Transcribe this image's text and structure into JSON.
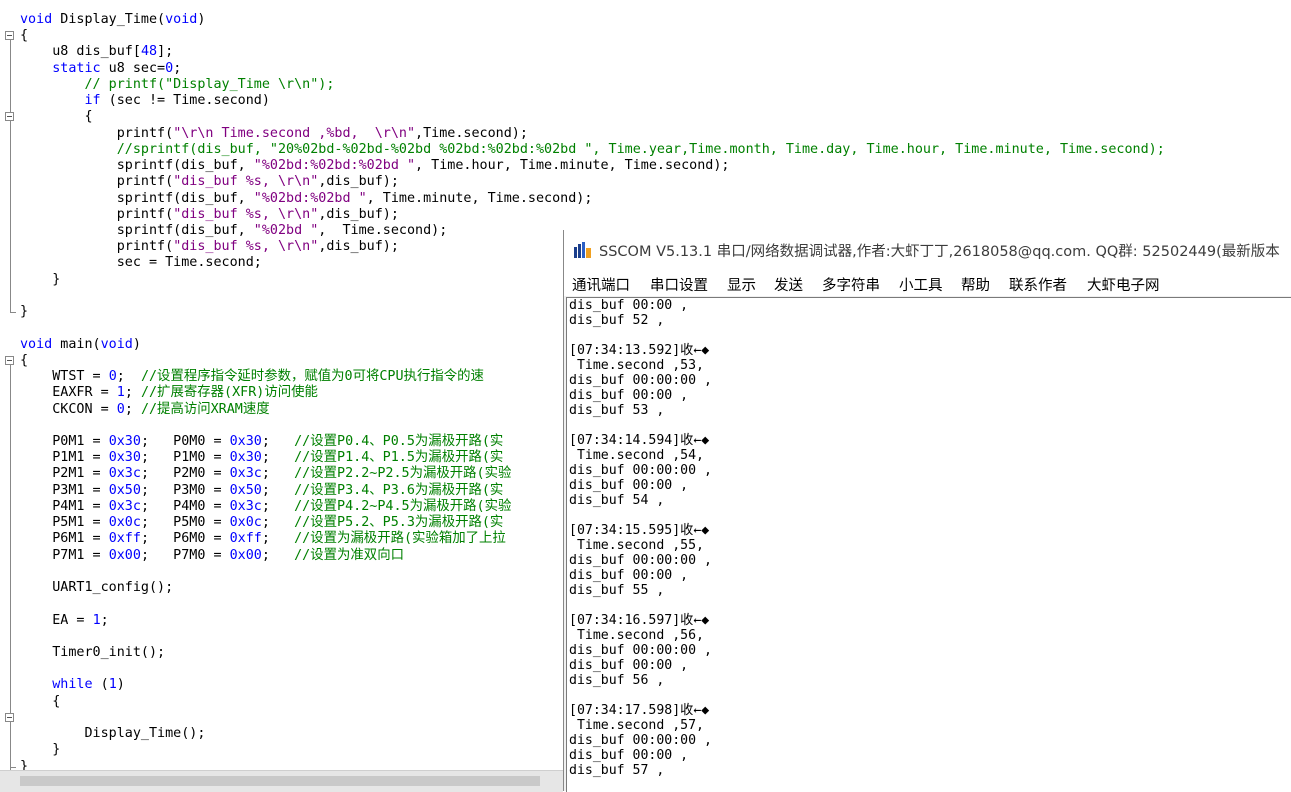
{
  "editor": {
    "lines": [
      [
        {
          "t": "void",
          "c": "kw"
        },
        {
          "t": " Display_Time("
        },
        {
          "t": "void",
          "c": "kw"
        },
        {
          "t": ")"
        }
      ],
      [
        {
          "t": "{"
        }
      ],
      [
        {
          "t": "    u8 dis_buf["
        },
        {
          "t": "48",
          "c": "num"
        },
        {
          "t": "];"
        }
      ],
      [
        {
          "t": "    "
        },
        {
          "t": "static",
          "c": "kw"
        },
        {
          "t": " u8 sec="
        },
        {
          "t": "0",
          "c": "num"
        },
        {
          "t": ";"
        }
      ],
      [
        {
          "t": "        // printf(\"Display_Time \\r\\n\");",
          "c": "cm"
        }
      ],
      [
        {
          "t": "        "
        },
        {
          "t": "if",
          "c": "kw"
        },
        {
          "t": " (sec != Time.second)"
        }
      ],
      [
        {
          "t": "        {"
        }
      ],
      [
        {
          "t": "            printf("
        },
        {
          "t": "\"\\r\\n Time.second ,%bd,  \\r\\n\"",
          "c": "str"
        },
        {
          "t": ",Time.second);"
        }
      ],
      [
        {
          "t": "            //sprintf(dis_buf, \"20%02bd-%02bd-%02bd %02bd:%02bd:%02bd \", Time.year,Time.month, Time.day, Time.hour, Time.minute, Time.second);",
          "c": "cm"
        }
      ],
      [
        {
          "t": "            sprintf(dis_buf, "
        },
        {
          "t": "\"%02bd:%02bd:%02bd \"",
          "c": "str"
        },
        {
          "t": ", Time.hour, Time.minute, Time.second);"
        }
      ],
      [
        {
          "t": "            printf("
        },
        {
          "t": "\"dis_buf %s, \\r\\n\"",
          "c": "str"
        },
        {
          "t": ",dis_buf);"
        }
      ],
      [
        {
          "t": "            sprintf(dis_buf, "
        },
        {
          "t": "\"%02bd:%02bd \"",
          "c": "str"
        },
        {
          "t": ", Time.minute, Time.second);"
        }
      ],
      [
        {
          "t": "            printf("
        },
        {
          "t": "\"dis_buf %s, \\r\\n\"",
          "c": "str"
        },
        {
          "t": ",dis_buf);"
        }
      ],
      [
        {
          "t": "            sprintf(dis_buf, "
        },
        {
          "t": "\"%02bd \"",
          "c": "str"
        },
        {
          "t": ",  Time.second);"
        }
      ],
      [
        {
          "t": "            printf("
        },
        {
          "t": "\"dis_buf %s, \\r\\n\"",
          "c": "str"
        },
        {
          "t": ",dis_buf);"
        }
      ],
      [
        {
          "t": "            sec = Time.second;"
        }
      ],
      [
        {
          "t": "    }"
        }
      ],
      [
        {
          "t": ""
        }
      ],
      [
        {
          "t": "}"
        }
      ],
      [
        {
          "t": ""
        }
      ],
      [
        {
          "t": "void",
          "c": "kw"
        },
        {
          "t": " main("
        },
        {
          "t": "void",
          "c": "kw"
        },
        {
          "t": ")"
        }
      ],
      [
        {
          "t": "{"
        }
      ],
      [
        {
          "t": "    WTST = "
        },
        {
          "t": "0",
          "c": "num"
        },
        {
          "t": ";  "
        },
        {
          "t": "//设置程序指令延时参数，赋值为0可将CPU执行指令的速",
          "c": "cm"
        }
      ],
      [
        {
          "t": "    EAXFR = "
        },
        {
          "t": "1",
          "c": "num"
        },
        {
          "t": "; "
        },
        {
          "t": "//扩展寄存器(XFR)访问使能",
          "c": "cm"
        }
      ],
      [
        {
          "t": "    CKCON = "
        },
        {
          "t": "0",
          "c": "num"
        },
        {
          "t": "; "
        },
        {
          "t": "//提高访问XRAM速度",
          "c": "cm"
        }
      ],
      [
        {
          "t": ""
        }
      ],
      [
        {
          "t": "    P0M1 = "
        },
        {
          "t": "0x30",
          "c": "num"
        },
        {
          "t": ";   P0M0 = "
        },
        {
          "t": "0x30",
          "c": "num"
        },
        {
          "t": ";   "
        },
        {
          "t": "//设置P0.4、P0.5为漏极开路(实",
          "c": "cm"
        }
      ],
      [
        {
          "t": "    P1M1 = "
        },
        {
          "t": "0x30",
          "c": "num"
        },
        {
          "t": ";   P1M0 = "
        },
        {
          "t": "0x30",
          "c": "num"
        },
        {
          "t": ";   "
        },
        {
          "t": "//设置P1.4、P1.5为漏极开路(实",
          "c": "cm"
        }
      ],
      [
        {
          "t": "    P2M1 = "
        },
        {
          "t": "0x3c",
          "c": "num"
        },
        {
          "t": ";   P2M0 = "
        },
        {
          "t": "0x3c",
          "c": "num"
        },
        {
          "t": ";   "
        },
        {
          "t": "//设置P2.2~P2.5为漏极开路(实验",
          "c": "cm"
        }
      ],
      [
        {
          "t": "    P3M1 = "
        },
        {
          "t": "0x50",
          "c": "num"
        },
        {
          "t": ";   P3M0 = "
        },
        {
          "t": "0x50",
          "c": "num"
        },
        {
          "t": ";   "
        },
        {
          "t": "//设置P3.4、P3.6为漏极开路(实",
          "c": "cm"
        }
      ],
      [
        {
          "t": "    P4M1 = "
        },
        {
          "t": "0x3c",
          "c": "num"
        },
        {
          "t": ";   P4M0 = "
        },
        {
          "t": "0x3c",
          "c": "num"
        },
        {
          "t": ";   "
        },
        {
          "t": "//设置P4.2~P4.5为漏极开路(实验",
          "c": "cm"
        }
      ],
      [
        {
          "t": "    P5M1 = "
        },
        {
          "t": "0x0c",
          "c": "num"
        },
        {
          "t": ";   P5M0 = "
        },
        {
          "t": "0x0c",
          "c": "num"
        },
        {
          "t": ";   "
        },
        {
          "t": "//设置P5.2、P5.3为漏极开路(实",
          "c": "cm"
        }
      ],
      [
        {
          "t": "    P6M1 = "
        },
        {
          "t": "0xff",
          "c": "num"
        },
        {
          "t": ";   P6M0 = "
        },
        {
          "t": "0xff",
          "c": "num"
        },
        {
          "t": ";   "
        },
        {
          "t": "//设置为漏极开路(实验箱加了上拉",
          "c": "cm"
        }
      ],
      [
        {
          "t": "    P7M1 = "
        },
        {
          "t": "0x00",
          "c": "num"
        },
        {
          "t": ";   P7M0 = "
        },
        {
          "t": "0x00",
          "c": "num"
        },
        {
          "t": ";   "
        },
        {
          "t": "//设置为准双向口",
          "c": "cm"
        }
      ],
      [
        {
          "t": ""
        }
      ],
      [
        {
          "t": "    UART1_config();"
        }
      ],
      [
        {
          "t": ""
        }
      ],
      [
        {
          "t": "    EA = "
        },
        {
          "t": "1",
          "c": "num"
        },
        {
          "t": ";"
        }
      ],
      [
        {
          "t": ""
        }
      ],
      [
        {
          "t": "    Timer0_init();"
        }
      ],
      [
        {
          "t": ""
        }
      ],
      [
        {
          "t": "    "
        },
        {
          "t": "while",
          "c": "kw"
        },
        {
          "t": " ("
        },
        {
          "t": "1",
          "c": "num"
        },
        {
          "t": ")"
        }
      ],
      [
        {
          "t": "    {"
        }
      ],
      [
        {
          "t": ""
        }
      ],
      [
        {
          "t": "        Display_Time();"
        }
      ],
      [
        {
          "t": "    }"
        }
      ],
      [
        {
          "t": "}"
        }
      ]
    ]
  },
  "sscom": {
    "title": "SSCOM V5.13.1 串口/网络数据调试器,作者:大虾丁丁,2618058@qq.com. QQ群: 52502449(最新版本",
    "menu": [
      "通讯端口",
      "串口设置",
      "显示",
      "发送",
      "多字符串",
      "小工具",
      "帮助",
      "联系作者",
      "大虾电子网"
    ],
    "receive_lines": [
      "dis_buf 00:00 ,",
      "dis_buf 52 ,",
      "",
      "[07:34:13.592]收←◆",
      " Time.second ,53,",
      "dis_buf 00:00:00 ,",
      "dis_buf 00:00 ,",
      "dis_buf 53 ,",
      "",
      "[07:34:14.594]收←◆",
      " Time.second ,54,",
      "dis_buf 00:00:00 ,",
      "dis_buf 00:00 ,",
      "dis_buf 54 ,",
      "",
      "[07:34:15.595]收←◆",
      " Time.second ,55,",
      "dis_buf 00:00:00 ,",
      "dis_buf 00:00 ,",
      "dis_buf 55 ,",
      "",
      "[07:34:16.597]收←◆",
      " Time.second ,56,",
      "dis_buf 00:00:00 ,",
      "dis_buf 00:00 ,",
      "dis_buf 56 ,",
      "",
      "[07:34:17.598]收←◆",
      " Time.second ,57,",
      "dis_buf 00:00:00 ,",
      "dis_buf 00:00 ,",
      "dis_buf 57 ,"
    ]
  },
  "colors": {
    "keyword": "#0000ff",
    "comment": "#008000",
    "string": "#800080",
    "number": "#0000ff"
  }
}
